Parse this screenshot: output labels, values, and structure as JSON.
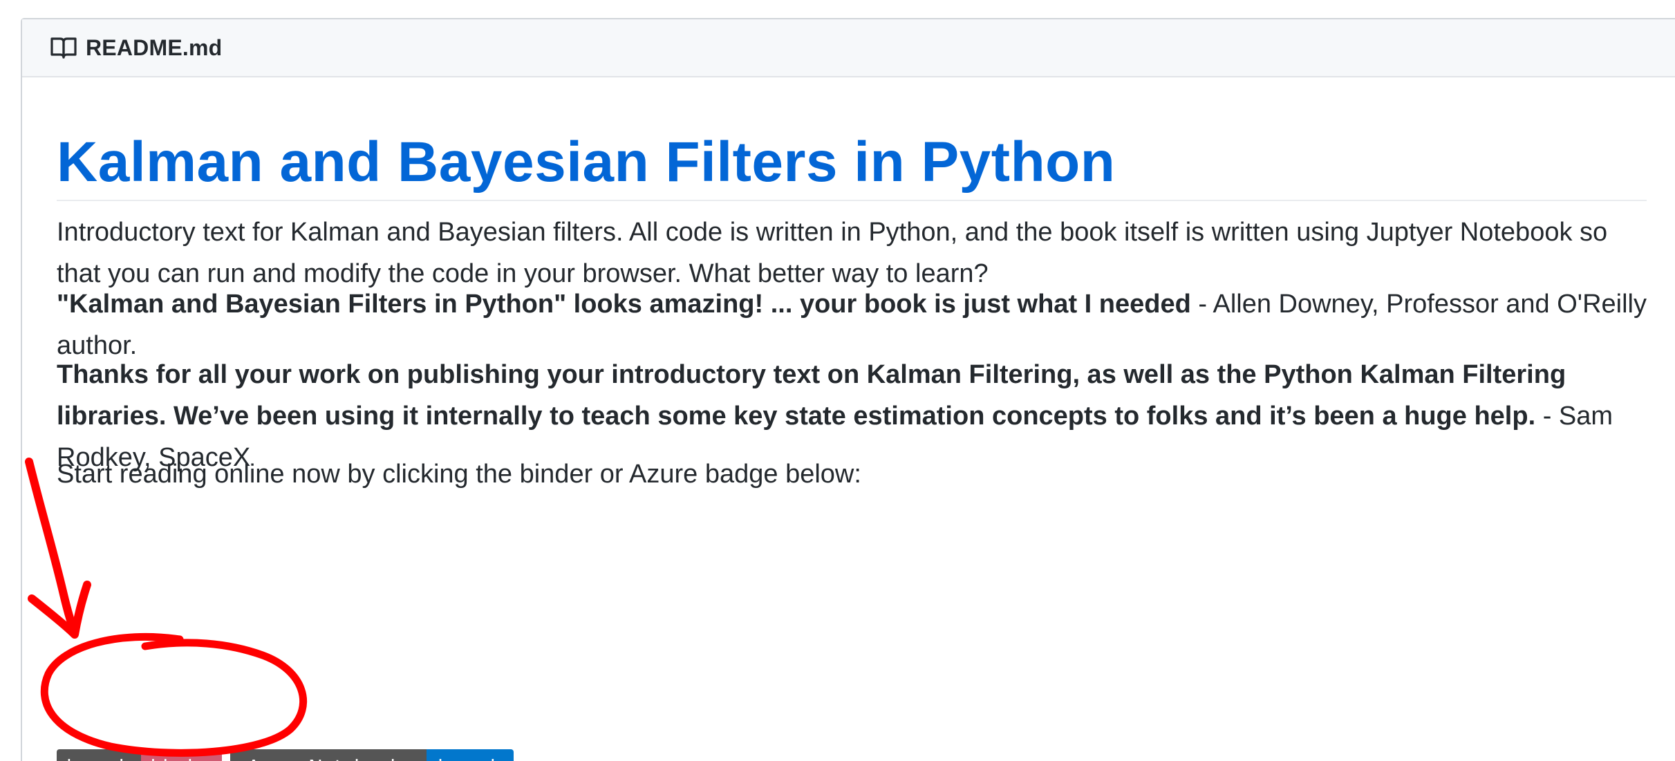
{
  "readme": {
    "filename": "README.md",
    "title": "Kalman and Bayesian Filters in Python",
    "intro": "Introductory text for Kalman and Bayesian filters. All code is written in Python, and the book itself is written using Juptyer Notebook so that you can run and modify the code in your browser. What better way to learn?",
    "quote1_bold": "\"Kalman and Bayesian Filters in Python\" looks amazing! ... your book is just what I needed",
    "quote1_attrib": " - Allen Downey, Professor and O'Reilly author.",
    "quote2_bold": "Thanks for all your work on publishing your introductory text on Kalman Filtering, as well as the Python Kalman Filtering libraries. We’ve been using it internally to teach some key state estimation concepts to folks and it’s been a huge help.",
    "quote2_attrib": " - Sam Rodkey, SpaceX",
    "start_reading": "Start reading online now by clicking the binder or Azure badge below:"
  },
  "badges": {
    "binder_left": "launch",
    "binder_right": "binder",
    "azure_left": "Azure Notebooks",
    "azure_right": "launch"
  },
  "colors": {
    "title": "#0366d6",
    "binder_right": "#d05b72",
    "azure_right": "#0277cc",
    "badge_left": "#555555",
    "annotation": "#ff0000"
  },
  "icons": {
    "header_icon": "book-icon"
  }
}
